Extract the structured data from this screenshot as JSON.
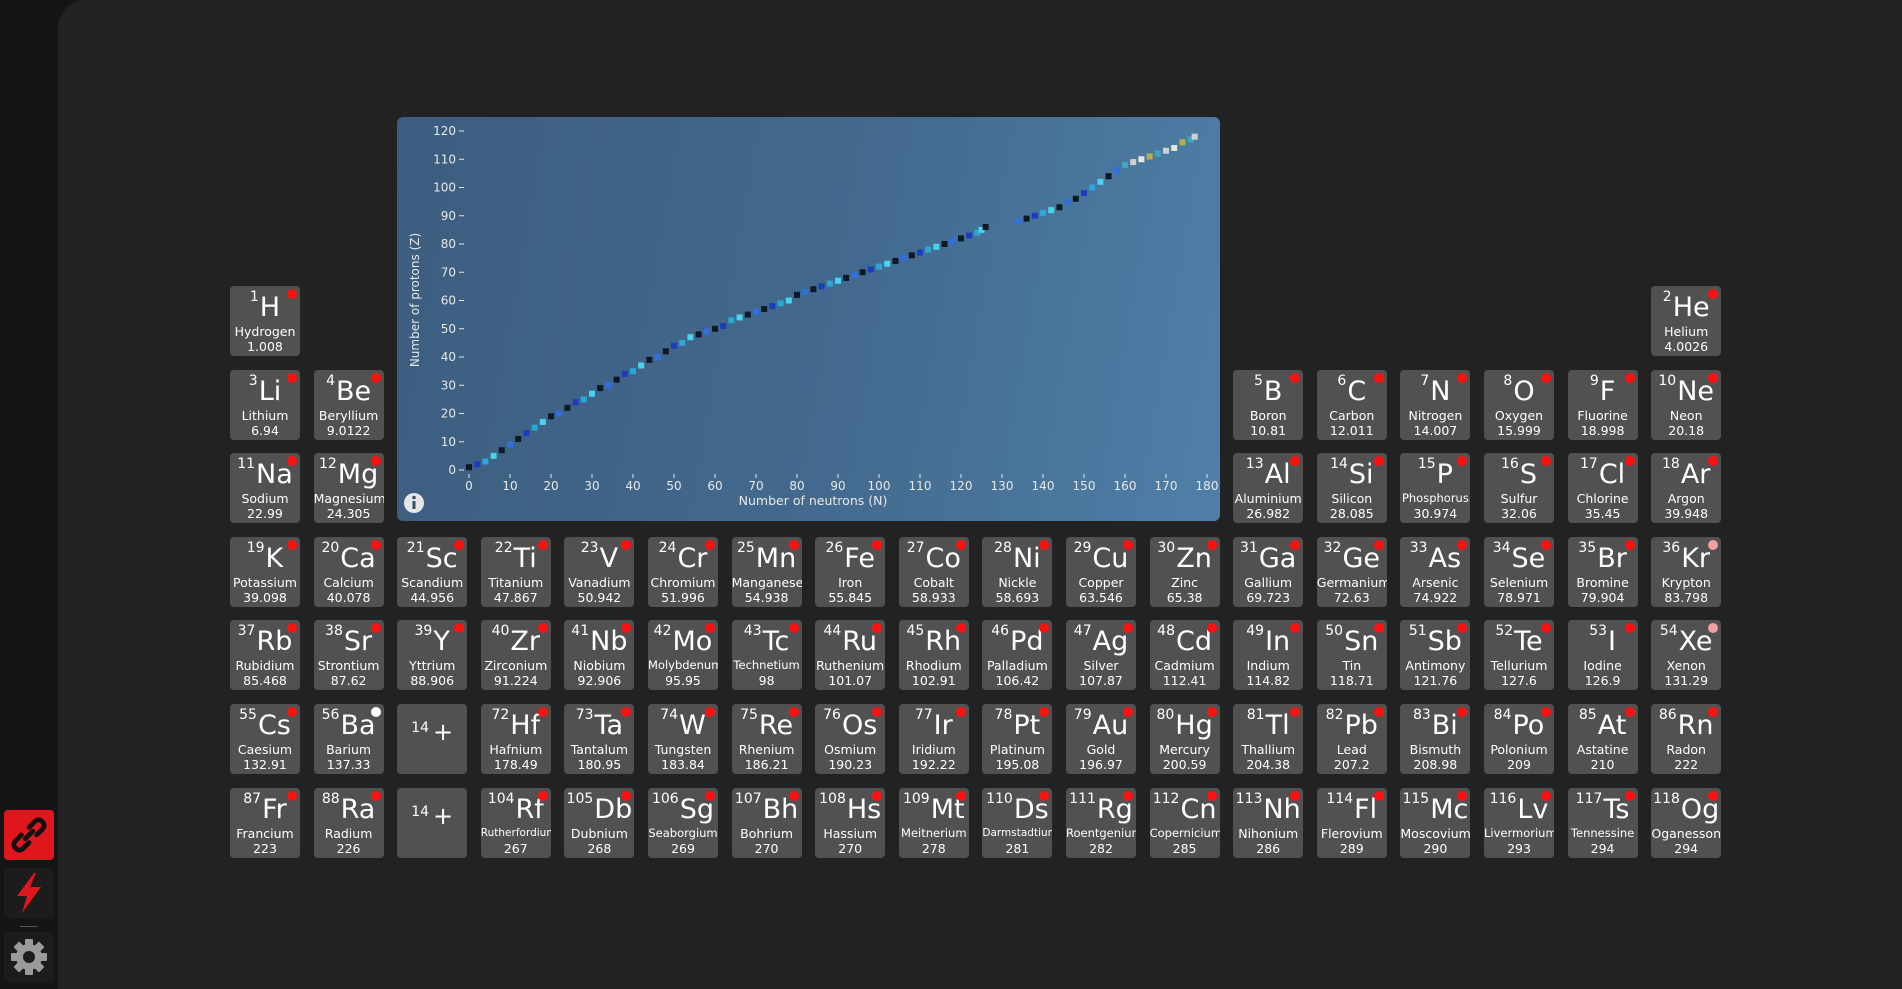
{
  "icons": {
    "link": "link-broken-icon",
    "flash": "lightning-icon",
    "gear": "gear-icon",
    "info": "info-icon"
  },
  "colors": {
    "accent": "#e0181e",
    "tile": "#515151",
    "dot_red": "#ff1010",
    "dot_white": "#ffffff",
    "dot_pink": "#f0a0a0"
  },
  "elements": [
    {
      "n": 1,
      "s": "H",
      "name": "Hydrogen",
      "m": "1.008",
      "r": 1,
      "c": 1,
      "dot": "red"
    },
    {
      "n": 2,
      "s": "He",
      "name": "Helium",
      "m": "4.0026",
      "r": 1,
      "c": 18,
      "dot": "red"
    },
    {
      "n": 3,
      "s": "Li",
      "name": "Lithium",
      "m": "6.94",
      "r": 2,
      "c": 1,
      "dot": "red"
    },
    {
      "n": 4,
      "s": "Be",
      "name": "Beryllium",
      "m": "9.0122",
      "r": 2,
      "c": 2,
      "dot": "red"
    },
    {
      "n": 5,
      "s": "B",
      "name": "Boron",
      "m": "10.81",
      "r": 2,
      "c": 13,
      "dot": "red"
    },
    {
      "n": 6,
      "s": "C",
      "name": "Carbon",
      "m": "12.011",
      "r": 2,
      "c": 14,
      "dot": "red"
    },
    {
      "n": 7,
      "s": "N",
      "name": "Nitrogen",
      "m": "14.007",
      "r": 2,
      "c": 15,
      "dot": "red"
    },
    {
      "n": 8,
      "s": "O",
      "name": "Oxygen",
      "m": "15.999",
      "r": 2,
      "c": 16,
      "dot": "red"
    },
    {
      "n": 9,
      "s": "F",
      "name": "Fluorine",
      "m": "18.998",
      "r": 2,
      "c": 17,
      "dot": "red"
    },
    {
      "n": 10,
      "s": "Ne",
      "name": "Neon",
      "m": "20.18",
      "r": 2,
      "c": 18,
      "dot": "red"
    },
    {
      "n": 11,
      "s": "Na",
      "name": "Sodium",
      "m": "22.99",
      "r": 3,
      "c": 1,
      "dot": "red"
    },
    {
      "n": 12,
      "s": "Mg",
      "name": "Magnesium",
      "m": "24.305",
      "r": 3,
      "c": 2,
      "dot": "red"
    },
    {
      "n": 13,
      "s": "Al",
      "name": "Aluminium",
      "m": "26.982",
      "r": 3,
      "c": 13,
      "dot": "red"
    },
    {
      "n": 14,
      "s": "Si",
      "name": "Silicon",
      "m": "28.085",
      "r": 3,
      "c": 14,
      "dot": "red"
    },
    {
      "n": 15,
      "s": "P",
      "name": "Phosphorus",
      "m": "30.974",
      "r": 3,
      "c": 15,
      "dot": "red"
    },
    {
      "n": 16,
      "s": "S",
      "name": "Sulfur",
      "m": "32.06",
      "r": 3,
      "c": 16,
      "dot": "red"
    },
    {
      "n": 17,
      "s": "Cl",
      "name": "Chlorine",
      "m": "35.45",
      "r": 3,
      "c": 17,
      "dot": "red"
    },
    {
      "n": 18,
      "s": "Ar",
      "name": "Argon",
      "m": "39.948",
      "r": 3,
      "c": 18,
      "dot": "red"
    },
    {
      "n": 19,
      "s": "K",
      "name": "Potassium",
      "m": "39.098",
      "r": 4,
      "c": 1,
      "dot": "red"
    },
    {
      "n": 20,
      "s": "Ca",
      "name": "Calcium",
      "m": "40.078",
      "r": 4,
      "c": 2,
      "dot": "red"
    },
    {
      "n": 21,
      "s": "Sc",
      "name": "Scandium",
      "m": "44.956",
      "r": 4,
      "c": 3,
      "dot": "red"
    },
    {
      "n": 22,
      "s": "Ti",
      "name": "Titanium",
      "m": "47.867",
      "r": 4,
      "c": 4,
      "dot": "red"
    },
    {
      "n": 23,
      "s": "V",
      "name": "Vanadium",
      "m": "50.942",
      "r": 4,
      "c": 5,
      "dot": "red"
    },
    {
      "n": 24,
      "s": "Cr",
      "name": "Chromium",
      "m": "51.996",
      "r": 4,
      "c": 6,
      "dot": "red"
    },
    {
      "n": 25,
      "s": "Mn",
      "name": "Manganese",
      "m": "54.938",
      "r": 4,
      "c": 7,
      "dot": "red"
    },
    {
      "n": 26,
      "s": "Fe",
      "name": "Iron",
      "m": "55.845",
      "r": 4,
      "c": 8,
      "dot": "red"
    },
    {
      "n": 27,
      "s": "Co",
      "name": "Cobalt",
      "m": "58.933",
      "r": 4,
      "c": 9,
      "dot": "red"
    },
    {
      "n": 28,
      "s": "Ni",
      "name": "Nickle",
      "m": "58.693",
      "r": 4,
      "c": 10,
      "dot": "red"
    },
    {
      "n": 29,
      "s": "Cu",
      "name": "Copper",
      "m": "63.546",
      "r": 4,
      "c": 11,
      "dot": "red"
    },
    {
      "n": 30,
      "s": "Zn",
      "name": "Zinc",
      "m": "65.38",
      "r": 4,
      "c": 12,
      "dot": "red"
    },
    {
      "n": 31,
      "s": "Ga",
      "name": "Gallium",
      "m": "69.723",
      "r": 4,
      "c": 13,
      "dot": "red"
    },
    {
      "n": 32,
      "s": "Ge",
      "name": "Germanium",
      "m": "72.63",
      "r": 4,
      "c": 14,
      "dot": "red"
    },
    {
      "n": 33,
      "s": "As",
      "name": "Arsenic",
      "m": "74.922",
      "r": 4,
      "c": 15,
      "dot": "red"
    },
    {
      "n": 34,
      "s": "Se",
      "name": "Selenium",
      "m": "78.971",
      "r": 4,
      "c": 16,
      "dot": "red"
    },
    {
      "n": 35,
      "s": "Br",
      "name": "Bromine",
      "m": "79.904",
      "r": 4,
      "c": 17,
      "dot": "red"
    },
    {
      "n": 36,
      "s": "Kr",
      "name": "Krypton",
      "m": "83.798",
      "r": 4,
      "c": 18,
      "dot": "pink"
    },
    {
      "n": 37,
      "s": "Rb",
      "name": "Rubidium",
      "m": "85.468",
      "r": 5,
      "c": 1,
      "dot": "red"
    },
    {
      "n": 38,
      "s": "Sr",
      "name": "Strontium",
      "m": "87.62",
      "r": 5,
      "c": 2,
      "dot": "red"
    },
    {
      "n": 39,
      "s": "Y",
      "name": "Yttrium",
      "m": "88.906",
      "r": 5,
      "c": 3,
      "dot": "red"
    },
    {
      "n": 40,
      "s": "Zr",
      "name": "Zirconium",
      "m": "91.224",
      "r": 5,
      "c": 4,
      "dot": "red"
    },
    {
      "n": 41,
      "s": "Nb",
      "name": "Niobium",
      "m": "92.906",
      "r": 5,
      "c": 5,
      "dot": "red"
    },
    {
      "n": 42,
      "s": "Mo",
      "name": "Molybdenum",
      "m": "95.95",
      "r": 5,
      "c": 6,
      "dot": "red"
    },
    {
      "n": 43,
      "s": "Tc",
      "name": "Technetium",
      "m": "98",
      "r": 5,
      "c": 7,
      "dot": "red"
    },
    {
      "n": 44,
      "s": "Ru",
      "name": "Ruthenium",
      "m": "101.07",
      "r": 5,
      "c": 8,
      "dot": "red"
    },
    {
      "n": 45,
      "s": "Rh",
      "name": "Rhodium",
      "m": "102.91",
      "r": 5,
      "c": 9,
      "dot": "red"
    },
    {
      "n": 46,
      "s": "Pd",
      "name": "Palladium",
      "m": "106.42",
      "r": 5,
      "c": 10,
      "dot": "red"
    },
    {
      "n": 47,
      "s": "Ag",
      "name": "Silver",
      "m": "107.87",
      "r": 5,
      "c": 11,
      "dot": "red"
    },
    {
      "n": 48,
      "s": "Cd",
      "name": "Cadmium",
      "m": "112.41",
      "r": 5,
      "c": 12,
      "dot": "red"
    },
    {
      "n": 49,
      "s": "In",
      "name": "Indium",
      "m": "114.82",
      "r": 5,
      "c": 13,
      "dot": "red"
    },
    {
      "n": 50,
      "s": "Sn",
      "name": "Tin",
      "m": "118.71",
      "r": 5,
      "c": 14,
      "dot": "red"
    },
    {
      "n": 51,
      "s": "Sb",
      "name": "Antimony",
      "m": "121.76",
      "r": 5,
      "c": 15,
      "dot": "red"
    },
    {
      "n": 52,
      "s": "Te",
      "name": "Tellurium",
      "m": "127.6",
      "r": 5,
      "c": 16,
      "dot": "red"
    },
    {
      "n": 53,
      "s": "I",
      "name": "Iodine",
      "m": "126.9",
      "r": 5,
      "c": 17,
      "dot": "red"
    },
    {
      "n": 54,
      "s": "Xe",
      "name": "Xenon",
      "m": "131.29",
      "r": 5,
      "c": 18,
      "dot": "pink"
    },
    {
      "n": 55,
      "s": "Cs",
      "name": "Caesium",
      "m": "132.91",
      "r": 6,
      "c": 1,
      "dot": "red"
    },
    {
      "n": 56,
      "s": "Ba",
      "name": "Barium",
      "m": "137.33",
      "r": 6,
      "c": 2,
      "dot": "white"
    },
    {
      "n": 72,
      "s": "Hf",
      "name": "Hafnium",
      "m": "178.49",
      "r": 6,
      "c": 4,
      "dot": "red"
    },
    {
      "n": 73,
      "s": "Ta",
      "name": "Tantalum",
      "m": "180.95",
      "r": 6,
      "c": 5,
      "dot": "red"
    },
    {
      "n": 74,
      "s": "W",
      "name": "Tungsten",
      "m": "183.84",
      "r": 6,
      "c": 6,
      "dot": "red"
    },
    {
      "n": 75,
      "s": "Re",
      "name": "Rhenium",
      "m": "186.21",
      "r": 6,
      "c": 7,
      "dot": "red"
    },
    {
      "n": 76,
      "s": "Os",
      "name": "Osmium",
      "m": "190.23",
      "r": 6,
      "c": 8,
      "dot": "red"
    },
    {
      "n": 77,
      "s": "Ir",
      "name": "Iridium",
      "m": "192.22",
      "r": 6,
      "c": 9,
      "dot": "red"
    },
    {
      "n": 78,
      "s": "Pt",
      "name": "Platinum",
      "m": "195.08",
      "r": 6,
      "c": 10,
      "dot": "red"
    },
    {
      "n": 79,
      "s": "Au",
      "name": "Gold",
      "m": "196.97",
      "r": 6,
      "c": 11,
      "dot": "red"
    },
    {
      "n": 80,
      "s": "Hg",
      "name": "Mercury",
      "m": "200.59",
      "r": 6,
      "c": 12,
      "dot": "red"
    },
    {
      "n": 81,
      "s": "Tl",
      "name": "Thallium",
      "m": "204.38",
      "r": 6,
      "c": 13,
      "dot": "red"
    },
    {
      "n": 82,
      "s": "Pb",
      "name": "Lead",
      "m": "207.2",
      "r": 6,
      "c": 14,
      "dot": "red"
    },
    {
      "n": 83,
      "s": "Bi",
      "name": "Bismuth",
      "m": "208.98",
      "r": 6,
      "c": 15,
      "dot": "red"
    },
    {
      "n": 84,
      "s": "Po",
      "name": "Polonium",
      "m": "209",
      "r": 6,
      "c": 16,
      "dot": "red"
    },
    {
      "n": 85,
      "s": "At",
      "name": "Astatine",
      "m": "210",
      "r": 6,
      "c": 17,
      "dot": "red"
    },
    {
      "n": 86,
      "s": "Rn",
      "name": "Radon",
      "m": "222",
      "r": 6,
      "c": 18,
      "dot": "red"
    },
    {
      "n": 87,
      "s": "Fr",
      "name": "Francium",
      "m": "223",
      "r": 7,
      "c": 1,
      "dot": "red"
    },
    {
      "n": 88,
      "s": "Ra",
      "name": "Radium",
      "m": "226",
      "r": 7,
      "c": 2,
      "dot": "red"
    },
    {
      "n": 104,
      "s": "Rf",
      "name": "Rutherfordium",
      "m": "267",
      "r": 7,
      "c": 4,
      "dot": "red"
    },
    {
      "n": 105,
      "s": "Db",
      "name": "Dubnium",
      "m": "268",
      "r": 7,
      "c": 5,
      "dot": "red"
    },
    {
      "n": 106,
      "s": "Sg",
      "name": "Seaborgium",
      "m": "269",
      "r": 7,
      "c": 6,
      "dot": "red"
    },
    {
      "n": 107,
      "s": "Bh",
      "name": "Bohrium",
      "m": "270",
      "r": 7,
      "c": 7,
      "dot": "red"
    },
    {
      "n": 108,
      "s": "Hs",
      "name": "Hassium",
      "m": "270",
      "r": 7,
      "c": 8,
      "dot": "red"
    },
    {
      "n": 109,
      "s": "Mt",
      "name": "Meitnerium",
      "m": "278",
      "r": 7,
      "c": 9,
      "dot": "red"
    },
    {
      "n": 110,
      "s": "Ds",
      "name": "Darmstadtium",
      "m": "281",
      "r": 7,
      "c": 10,
      "dot": "red"
    },
    {
      "n": 111,
      "s": "Rg",
      "name": "Roentgenium",
      "m": "282",
      "r": 7,
      "c": 11,
      "dot": "red"
    },
    {
      "n": 112,
      "s": "Cn",
      "name": "Copernicium",
      "m": "285",
      "r": 7,
      "c": 12,
      "dot": "red"
    },
    {
      "n": 113,
      "s": "Nh",
      "name": "Nihonium",
      "m": "286",
      "r": 7,
      "c": 13,
      "dot": "red"
    },
    {
      "n": 114,
      "s": "Fl",
      "name": "Flerovium",
      "m": "289",
      "r": 7,
      "c": 14,
      "dot": "red"
    },
    {
      "n": 115,
      "s": "Mc",
      "name": "Moscovium",
      "m": "290",
      "r": 7,
      "c": 15,
      "dot": "red"
    },
    {
      "n": 116,
      "s": "Lv",
      "name": "Livermorium",
      "m": "293",
      "r": 7,
      "c": 16,
      "dot": "red"
    },
    {
      "n": 117,
      "s": "Ts",
      "name": "Tennessine",
      "m": "294",
      "r": 7,
      "c": 17,
      "dot": "red"
    },
    {
      "n": 118,
      "s": "Og",
      "name": "Oganesson",
      "m": "294",
      "r": 7,
      "c": 18,
      "dot": "red"
    }
  ],
  "placeholders": [
    {
      "n": "14",
      "sym": "+",
      "r": 6,
      "c": 3
    },
    {
      "n": "14",
      "sym": "+",
      "r": 7,
      "c": 3
    }
  ],
  "chart_data": {
    "type": "scatter",
    "xlabel": "Number of neutrons (N)",
    "ylabel": "Number of protons (Z)",
    "xlim": [
      0,
      180
    ],
    "ylim": [
      0,
      120
    ],
    "xticks": [
      0,
      10,
      20,
      30,
      40,
      50,
      60,
      70,
      80,
      90,
      100,
      110,
      120,
      130,
      140,
      150,
      160,
      170,
      180
    ],
    "yticks": [
      0,
      10,
      20,
      30,
      40,
      50,
      60,
      70,
      80,
      90,
      100,
      110,
      120
    ],
    "grid": false,
    "series": [
      {
        "values": [
          [
            0,
            1
          ],
          [
            2,
            2
          ],
          [
            4,
            3
          ],
          [
            6,
            5
          ],
          [
            8,
            7
          ],
          [
            10,
            9
          ],
          [
            12,
            11
          ],
          [
            14,
            13
          ],
          [
            16,
            15
          ],
          [
            18,
            17
          ],
          [
            20,
            19
          ],
          [
            22,
            20
          ],
          [
            24,
            22
          ],
          [
            26,
            24
          ],
          [
            28,
            25
          ],
          [
            30,
            27
          ],
          [
            32,
            29
          ],
          [
            34,
            30
          ],
          [
            36,
            32
          ],
          [
            38,
            34
          ],
          [
            40,
            35
          ],
          [
            42,
            37
          ],
          [
            44,
            39
          ],
          [
            46,
            40
          ],
          [
            48,
            42
          ],
          [
            50,
            44
          ],
          [
            52,
            45
          ],
          [
            54,
            47
          ],
          [
            56,
            48
          ],
          [
            58,
            49
          ],
          [
            60,
            50
          ],
          [
            62,
            51
          ],
          [
            64,
            53
          ],
          [
            66,
            54
          ],
          [
            68,
            55
          ],
          [
            70,
            56
          ],
          [
            72,
            57
          ],
          [
            74,
            58
          ],
          [
            76,
            59
          ],
          [
            78,
            60
          ],
          [
            80,
            62
          ],
          [
            82,
            63
          ],
          [
            84,
            64
          ],
          [
            86,
            65
          ],
          [
            88,
            66
          ],
          [
            90,
            67
          ],
          [
            92,
            68
          ],
          [
            94,
            69
          ],
          [
            96,
            70
          ],
          [
            98,
            71
          ],
          [
            100,
            72
          ],
          [
            102,
            73
          ],
          [
            104,
            74
          ],
          [
            106,
            75
          ],
          [
            108,
            76
          ],
          [
            110,
            77
          ],
          [
            112,
            78
          ],
          [
            114,
            79
          ],
          [
            116,
            80
          ],
          [
            118,
            81
          ],
          [
            120,
            82
          ],
          [
            122,
            83
          ],
          [
            124,
            84
          ],
          [
            125,
            85
          ],
          [
            126,
            86
          ],
          [
            134,
            88
          ],
          [
            136,
            89
          ],
          [
            138,
            90
          ],
          [
            140,
            91
          ],
          [
            142,
            92
          ],
          [
            144,
            93
          ],
          [
            146,
            95
          ],
          [
            148,
            96
          ],
          [
            150,
            98
          ],
          [
            152,
            100
          ],
          [
            154,
            102
          ],
          [
            156,
            104
          ],
          [
            158,
            106
          ],
          [
            160,
            108
          ],
          [
            162,
            109
          ],
          [
            164,
            110
          ],
          [
            166,
            111
          ],
          [
            168,
            112
          ],
          [
            170,
            113
          ],
          [
            172,
            114
          ],
          [
            174,
            116
          ],
          [
            176,
            117
          ],
          [
            177,
            118
          ]
        ]
      }
    ]
  }
}
